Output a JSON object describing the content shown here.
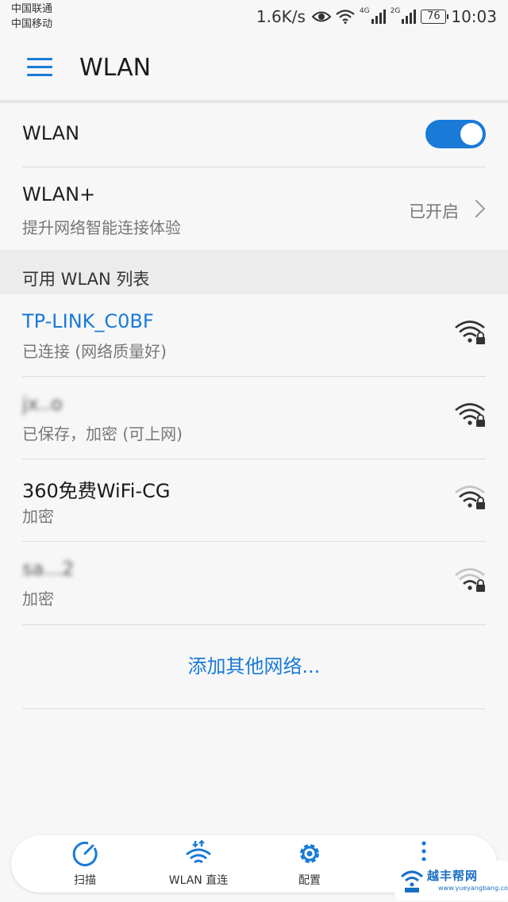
{
  "status_bar": {
    "carrier_1": "中国联通",
    "carrier_2": "中国移动",
    "speed": "1.6K/s",
    "net_tag_1": "4G",
    "net_tag_2": "2G",
    "battery": "76",
    "time": "10:03",
    "icons": [
      "eye-icon",
      "wifi-icon",
      "signal-4g-icon",
      "signal-2g-icon",
      "battery-icon"
    ]
  },
  "app_bar": {
    "title": "WLAN",
    "menu_icon": "hamburger-menu-icon"
  },
  "wlan_toggle": {
    "label": "WLAN",
    "on": true
  },
  "wlan_plus": {
    "title": "WLAN+",
    "subtitle": "提升网络智能连接体验",
    "status": "已开启"
  },
  "section_header": "可用 WLAN 列表",
  "networks": [
    {
      "name": "TP-LINK_C0BF",
      "status": "已连接 (网络质量好)",
      "connected": true,
      "secured": true,
      "signal": "strong"
    },
    {
      "name": "jx..o",
      "status": "已保存，加密 (可上网)",
      "connected": false,
      "secured": true,
      "signal": "strong",
      "blurred": true
    },
    {
      "name": "360免费WiFi-CG",
      "status": "加密",
      "connected": false,
      "secured": true,
      "signal": "medium"
    },
    {
      "name": "sa...2",
      "status": "加密",
      "connected": false,
      "secured": true,
      "signal": "weak",
      "blurred": true
    }
  ],
  "add_network": "添加其他网络...",
  "bottom_nav": [
    {
      "label": "扫描",
      "icon": "refresh-icon"
    },
    {
      "label": "WLAN 直连",
      "icon": "wifi-direct-icon"
    },
    {
      "label": "配置",
      "icon": "gear-icon"
    },
    {
      "label": "",
      "icon": "more-vertical-icon"
    }
  ],
  "watermark": {
    "text": "越丰帮网",
    "url": "www.yueyangbang.com"
  },
  "colors": {
    "accent": "#1a7ad8",
    "background": "#f7f7f7",
    "section_bg": "#ececec",
    "secondary_text": "#777777"
  }
}
